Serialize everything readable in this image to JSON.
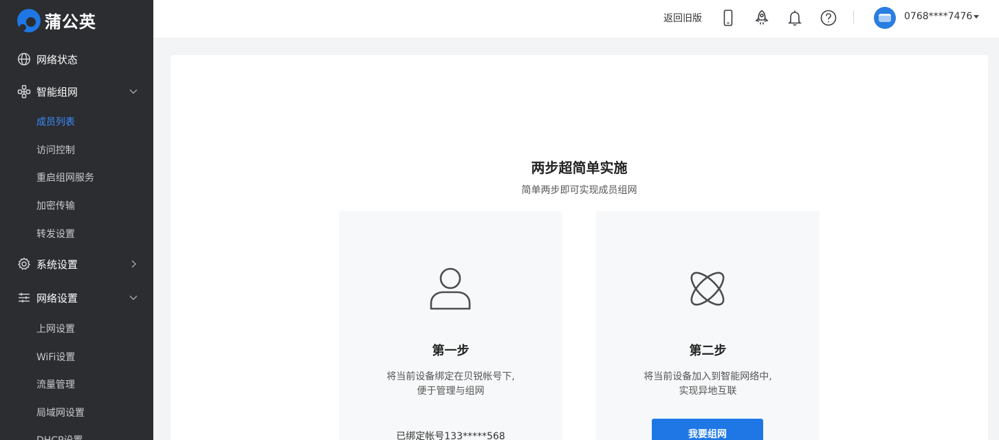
{
  "brand": {
    "name": "蒲公英",
    "accent": "#1f77e6",
    "sidebar_bg": "#2b2d31",
    "active_color": "#3b8cff"
  },
  "sidebar": {
    "groups": [
      {
        "label": "网络状态",
        "icon": "globe-icon"
      },
      {
        "label": "智能组网",
        "icon": "network-nodes-icon",
        "expanded": true,
        "items": [
          "成员列表",
          "访问控制",
          "重启组网服务",
          "加密传输",
          "转发设置"
        ]
      },
      {
        "label": "系统设置",
        "icon": "gear-icon",
        "expanded": false
      },
      {
        "label": "网络设置",
        "icon": "sliders-icon",
        "expanded": true,
        "items": [
          "上网设置",
          "WiFi设置",
          "流量管理",
          "局域网设置",
          "DHCP设置"
        ]
      }
    ],
    "active_item": "成员列表"
  },
  "header": {
    "legacy_link": "返回旧版",
    "icons": [
      "phone-icon",
      "rocket-icon",
      "bell-icon",
      "help-icon"
    ],
    "account": "0768****7476"
  },
  "main": {
    "title": "两步超简单实施",
    "subtitle": "简单两步即可实现成员组网",
    "steps": [
      {
        "title": "第一步",
        "icon": "user-icon",
        "desc_lines": [
          "将当前设备绑定在贝锐帐号下,",
          "便于管理与组网"
        ],
        "bound_account": "已绑定帐号133*****568"
      },
      {
        "title": "第二步",
        "icon": "atom-icon",
        "desc_lines": [
          "将当前设备加入到智能网络中,",
          "实现异地互联"
        ],
        "button_label": "我要组网"
      }
    ]
  }
}
